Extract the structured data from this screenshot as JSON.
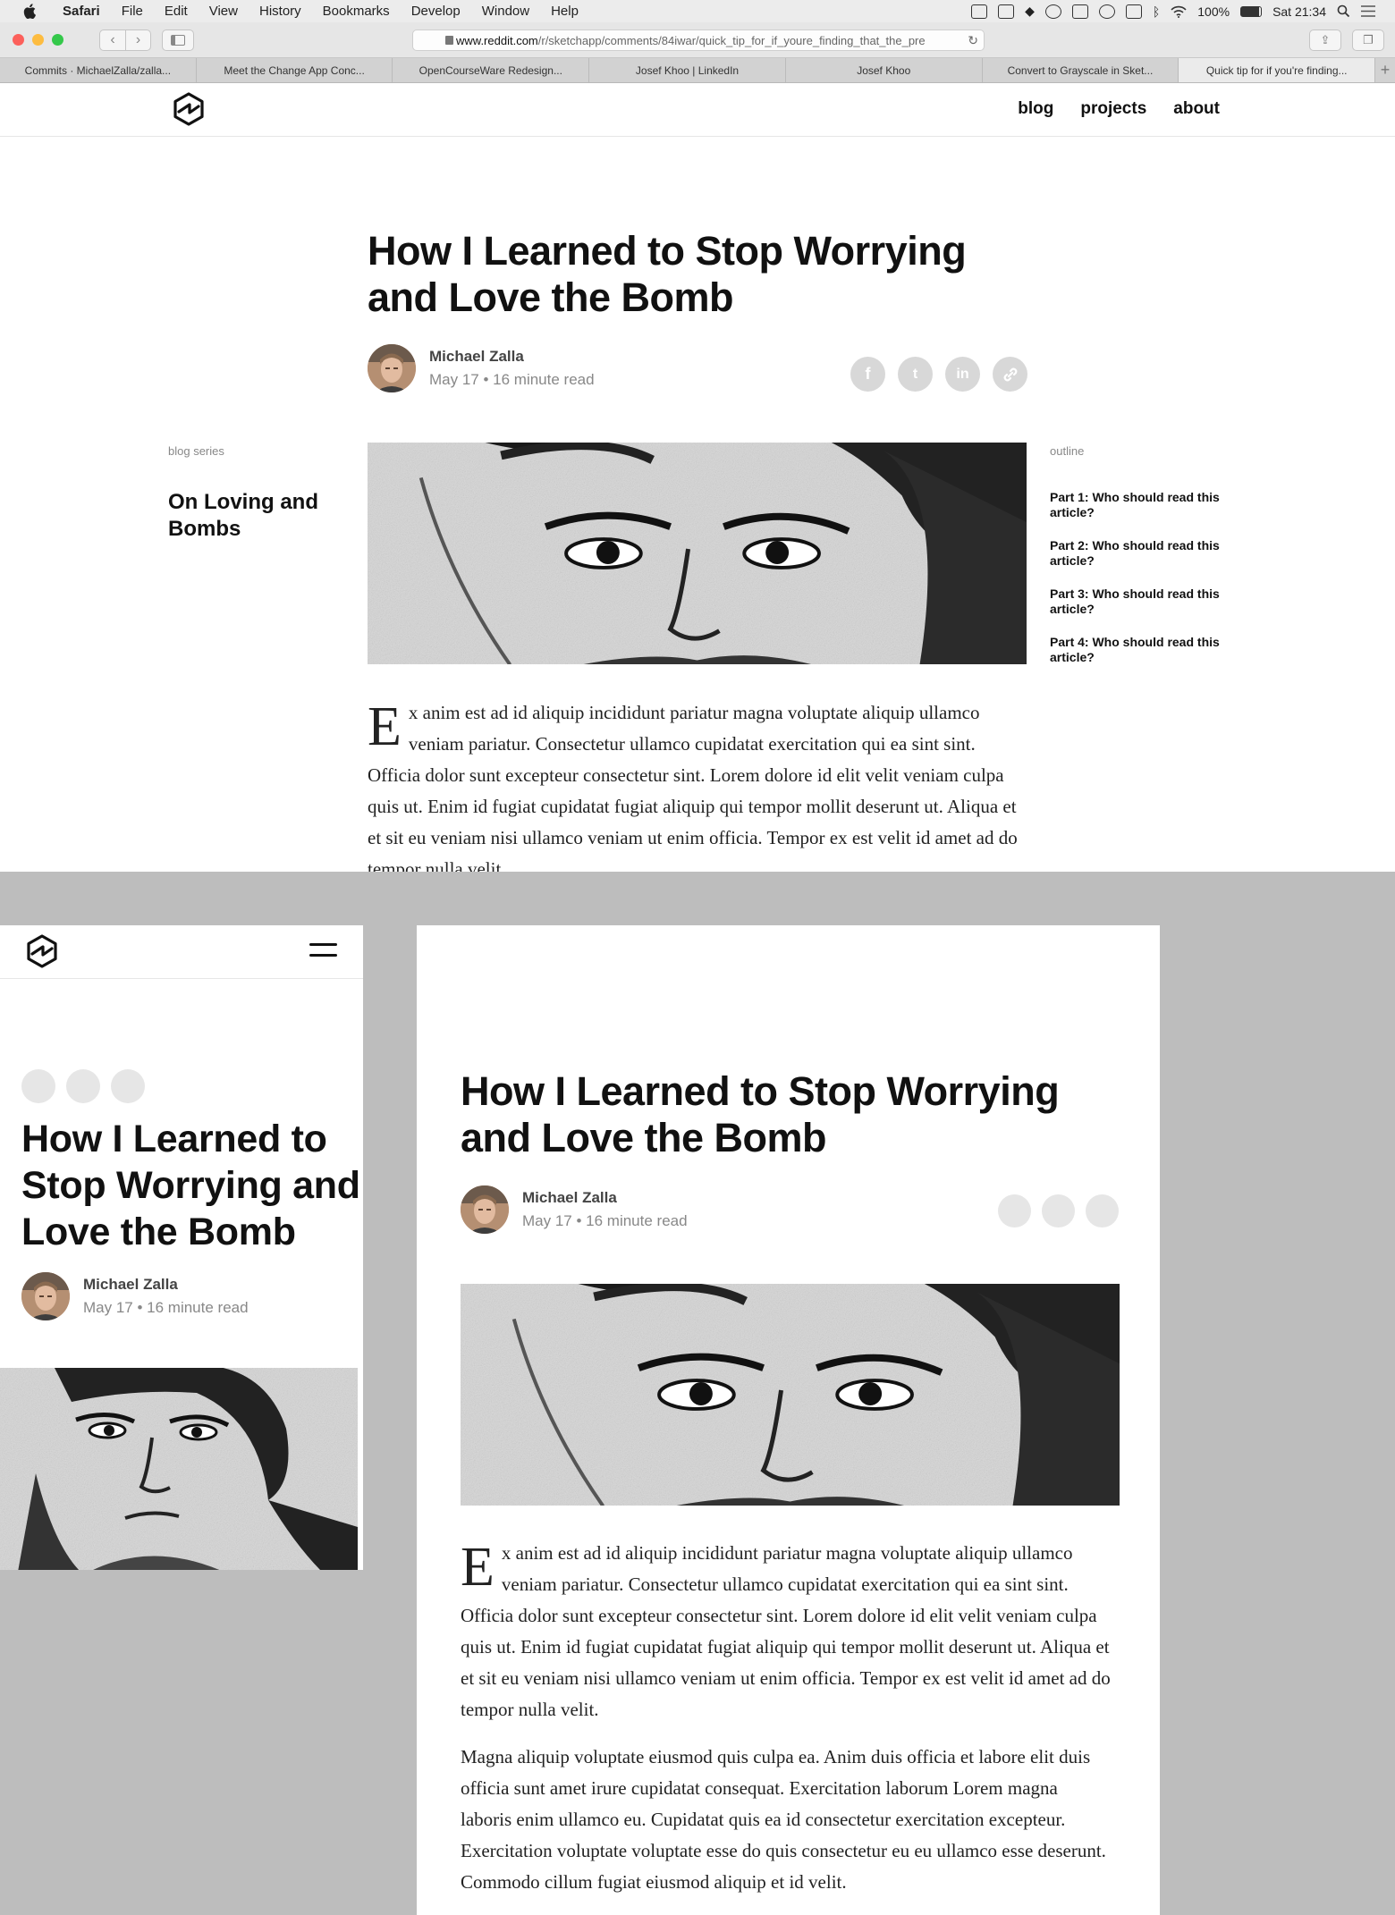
{
  "menubar": {
    "app": "Safari",
    "items": [
      "File",
      "Edit",
      "View",
      "History",
      "Bookmarks",
      "Develop",
      "Window",
      "Help"
    ],
    "battery": "100%",
    "clock": "Sat 21:34"
  },
  "browser": {
    "url_domain": "www.reddit.com",
    "url_path": "/r/sketchapp/comments/84iwar/quick_tip_for_if_youre_finding_that_the_pre",
    "tabs": [
      "Commits · MichaelZalla/zalla...",
      "Meet the Change App Conc...",
      "OpenCourseWare Redesign...",
      "Josef Khoo | LinkedIn",
      "Josef Khoo",
      "Convert to Grayscale in Sket...",
      "Quick tip for if you're finding..."
    ],
    "active_tab": 6
  },
  "site": {
    "nav": [
      "blog",
      "projects",
      "about"
    ],
    "post_title": "How I Learned to Stop Worrying and Love the Bomb",
    "author": "Michael Zalla",
    "meta": "May 17 • 16 minute read",
    "share": [
      "f",
      "t",
      "in",
      "link"
    ],
    "series_label": "blog series",
    "series_title": "On Loving and Bombs",
    "outline_label": "outline",
    "outline": [
      "Part 1: Who should read this article?",
      "Part 2: Who should read this article?",
      "Part 3: Who should read this article?",
      "Part 4: Who should read this article?"
    ],
    "dropcap": "E",
    "para1": "x anim est ad id aliquip incididunt pariatur magna voluptate aliquip ullamco veniam pariatur. Consectetur ullamco cupidatat exercitation qui ea sint sint. Officia dolor sunt excepteur consectetur sint. Lorem dolore id elit velit veniam culpa quis ut. Enim id fugiat cupidatat fugiat aliquip qui tempor mollit deserunt ut. Aliqua et et sit eu veniam nisi ullamco veniam ut enim officia. Tempor ex est velit id amet ad do tempor nulla velit.",
    "para2": "Magna aliquip voluptate eiusmod quis culpa ea. Anim duis officia et labore elit duis officia sunt amet irure cupidatat consequat. Exercitation laborum Lorem magna laboris enim ullamco eu. Cupidatat quis ea id consectetur exercitation excepteur. Exercitation voluptate voluptate esse do quis consectetur eu eu ullamco esse deserunt. Commodo cillum fugiat eiusmod aliquip et id velit."
  },
  "colors": {
    "page_bg": "#bdbdbd",
    "share_bg": "#d8d8d8",
    "traffic_red": "#fc605b",
    "traffic_yellow": "#fdbc40",
    "traffic_green": "#34c84a"
  }
}
